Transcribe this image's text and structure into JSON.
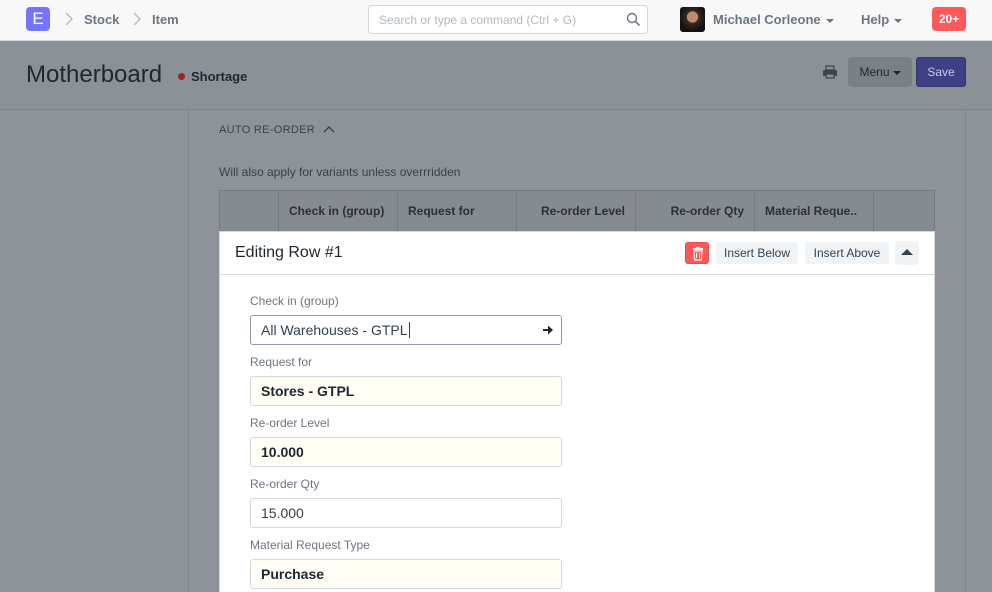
{
  "navbar": {
    "logo_letter": "E",
    "breadcrumbs": [
      "Stock",
      "Item"
    ],
    "search_placeholder": "Search or type a command (Ctrl + G)",
    "user_name": "Michael Corleone",
    "help_label": "Help",
    "notification_count": "20+"
  },
  "page": {
    "title": "Motherboard",
    "status": "Shortage",
    "status_color": "#a32323",
    "menu_label": "Menu",
    "save_label": "Save"
  },
  "section": {
    "title": "AUTO RE-ORDER",
    "description": "Will also apply for variants unless overrridden"
  },
  "grid": {
    "columns": [
      "Check in (group)",
      "Request for",
      "Re-order Level",
      "Re-order Qty",
      "Material Reque.."
    ]
  },
  "edit_row": {
    "title": "Editing Row #1",
    "insert_below_label": "Insert Below",
    "insert_above_label": "Insert Above",
    "fields": [
      {
        "label": "Check in (group)",
        "value": "All Warehouses - GTPL"
      },
      {
        "label": "Request for",
        "value": "Stores - GTPL"
      },
      {
        "label": "Re-order Level",
        "value": "10.000"
      },
      {
        "label": "Re-order Qty",
        "value": "15.000"
      },
      {
        "label": "Material Request Type",
        "value": "Purchase"
      }
    ]
  },
  "colors": {
    "brand": "#7575ff",
    "notification": "#ff5858",
    "primary_button": "#5e64ff",
    "delete_button": "#ff5858"
  }
}
